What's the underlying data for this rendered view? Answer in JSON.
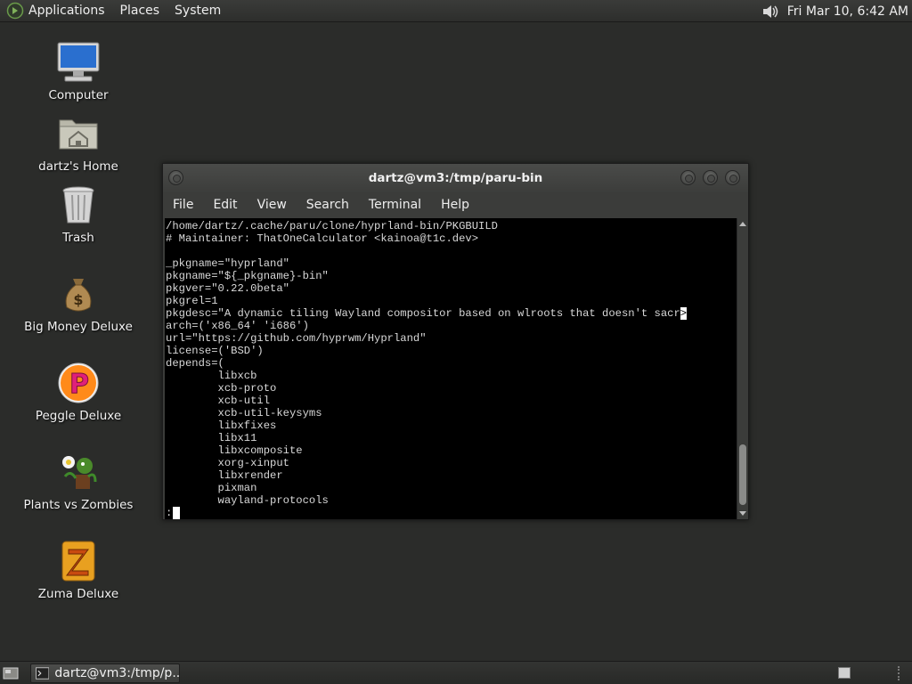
{
  "top_panel": {
    "menus": [
      "Applications",
      "Places",
      "System"
    ],
    "clock": "Fri Mar 10,  6:42 AM",
    "icons": {
      "menu_logo": "gnome-foot-icon",
      "volume": "speaker-volume-icon"
    }
  },
  "desktop_icons": [
    {
      "label": "Computer",
      "icon": "computer-icon"
    },
    {
      "label": "dartz's Home",
      "icon": "home-folder-icon"
    },
    {
      "label": "Trash",
      "icon": "trash-icon"
    },
    {
      "label": "Big Money Deluxe",
      "icon": "money-bag-icon"
    },
    {
      "label": "Peggle Deluxe",
      "icon": "peggle-icon"
    },
    {
      "label": "Plants vs Zombies",
      "icon": "plants-vs-zombies-icon"
    },
    {
      "label": "Zuma Deluxe",
      "icon": "zuma-icon"
    }
  ],
  "window": {
    "title": "dartz@vm3:/tmp/paru-bin",
    "menu": [
      "File",
      "Edit",
      "View",
      "Search",
      "Terminal",
      "Help"
    ],
    "terminal_lines": [
      "/home/dartz/.cache/paru/clone/hyprland-bin/PKGBUILD",
      "# Maintainer: ThatOneCalculator <kainoa@t1c.dev>",
      "",
      "_pkgname=\"hyprland\"",
      "pkgname=\"${_pkgname}-bin\"",
      "pkgver=\"0.22.0beta\"",
      "pkgrel=1",
      "pkgdesc=\"A dynamic tiling Wayland compositor based on wlroots that doesn't sacr",
      "arch=('x86_64' 'i686')",
      "url=\"https://github.com/hyprwm/Hyprland\"",
      "license=('BSD')",
      "depends=(",
      "        libxcb",
      "        xcb-proto",
      "        xcb-util",
      "        xcb-util-keysyms",
      "        libxfixes",
      "        libx11",
      "        libxcomposite",
      "        xorg-xinput",
      "        libxrender",
      "        pixman",
      "        wayland-protocols"
    ],
    "truncation_marker": ">",
    "prompt": ":"
  },
  "bottom_panel": {
    "task_label": "dartz@vm3:/tmp/p...",
    "icons": {
      "show_desktop": "show-desktop-icon",
      "task": "terminal-icon",
      "workspace": "workspace-switcher-icon"
    }
  },
  "colors": {
    "desktop_bg": "#2b2c2a",
    "panel_bg": "#333432",
    "terminal_bg": "#000000",
    "terminal_fg": "#d8d8d8"
  }
}
